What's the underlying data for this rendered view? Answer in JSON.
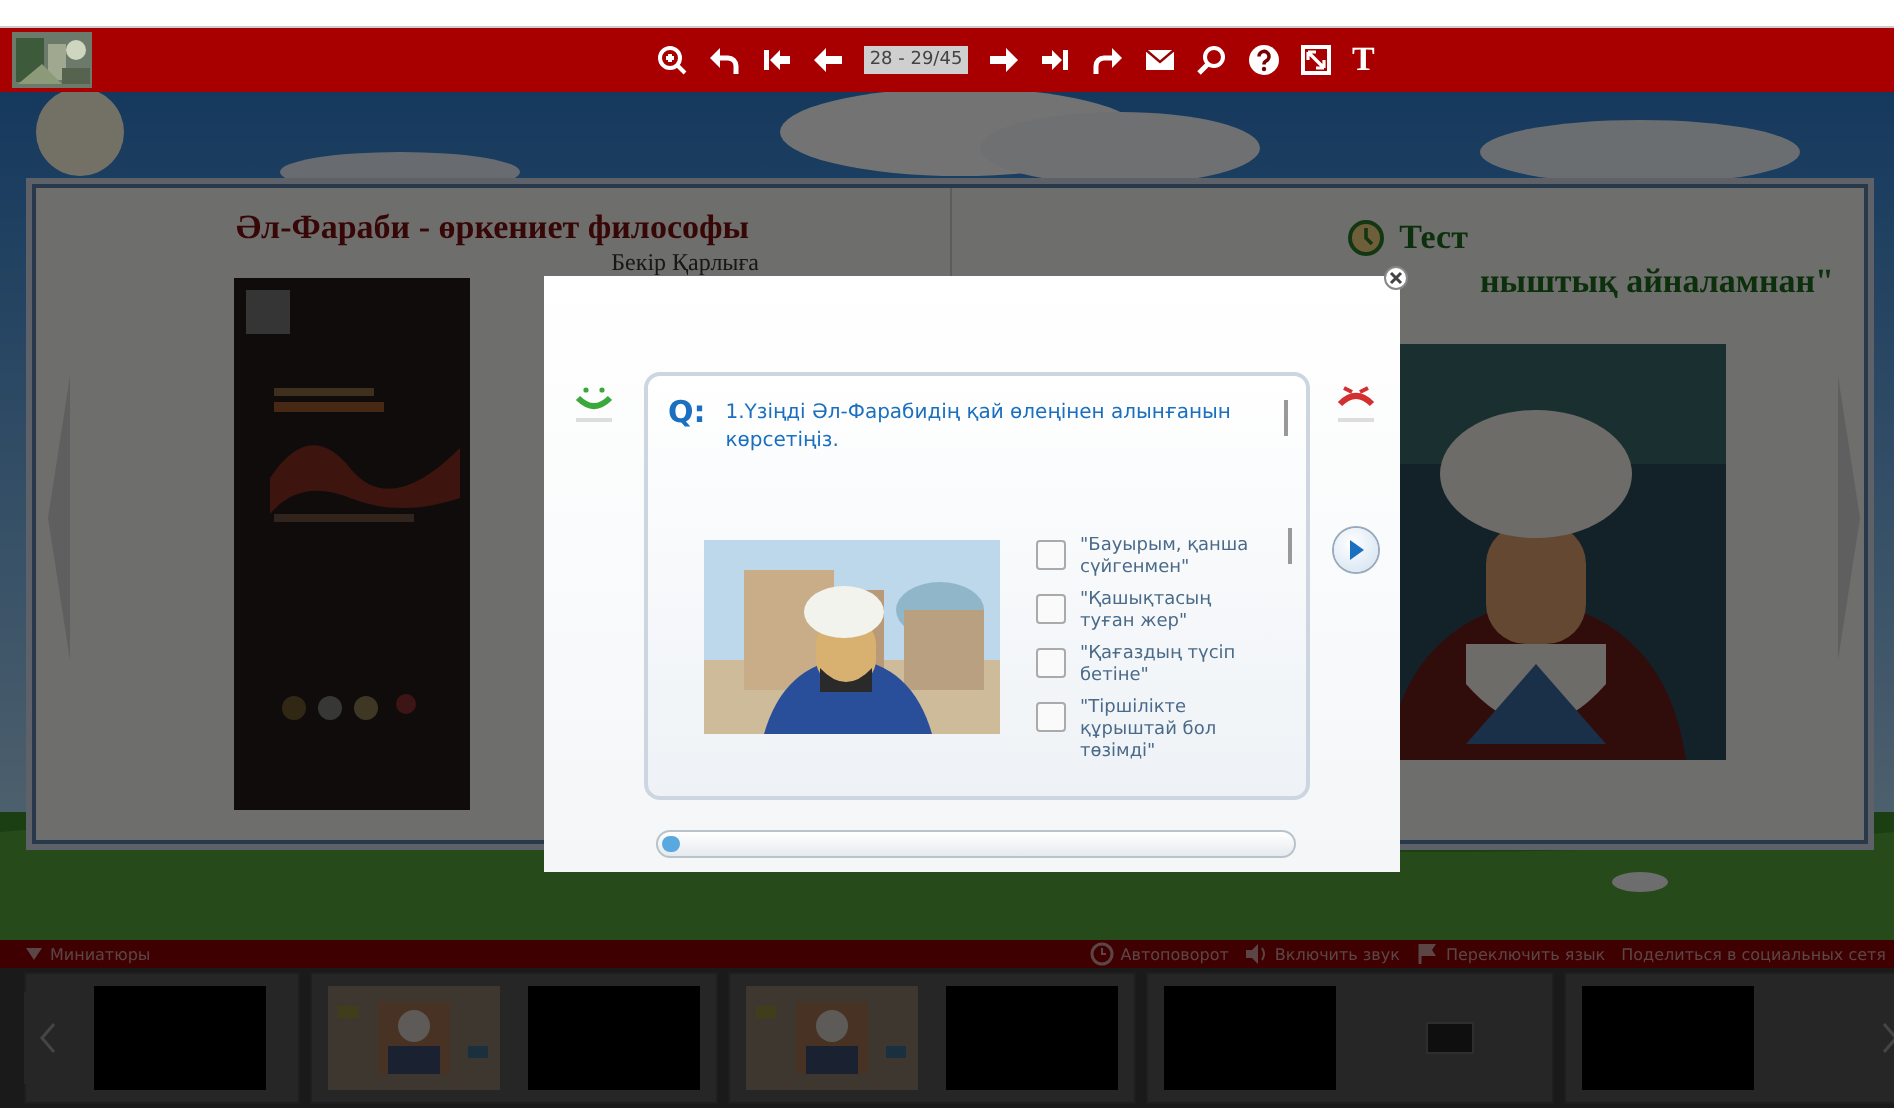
{
  "toolbar": {
    "buttons": [
      {
        "kind": "zoom-in"
      },
      {
        "kind": "undo"
      },
      {
        "kind": "first"
      },
      {
        "kind": "prev"
      },
      {
        "kind": "counter",
        "label": "28 - 29/45"
      },
      {
        "kind": "next"
      },
      {
        "kind": "last"
      },
      {
        "kind": "redo"
      },
      {
        "kind": "mail"
      },
      {
        "kind": "search"
      },
      {
        "kind": "help"
      },
      {
        "kind": "fullscreen"
      },
      {
        "kind": "text",
        "label": "T"
      }
    ]
  },
  "book": {
    "left_page": {
      "title": "Әл-Фараби - өркениет философы",
      "author": "Бекір Қарлыға"
    },
    "right_page": {
      "heading": "Тест",
      "title_fragment": "ныштық айналамнан\""
    }
  },
  "quiz": {
    "question_mark": "Q:",
    "question": "1.Үзіңді Әл-Фарабидің қай өлеңінен алынғанын көрсетіңіз.",
    "options": [
      {
        "label": "\"Бауырым, қанша сүйгенмен\"",
        "checked": false
      },
      {
        "label": "\"Қашықтасың туған жер\"",
        "checked": false
      },
      {
        "label": "\"Қағаздың түсіп бетіне\"",
        "checked": false
      },
      {
        "label": "\"Тіршілікте құрыштай бол төзімді\"",
        "checked": false
      }
    ],
    "progress": {
      "level": 0.03
    }
  },
  "bottom_bar": {
    "thumbnails_label": "Миниатюры",
    "actions": [
      {
        "kind": "autoturn",
        "label": "Автоповорот"
      },
      {
        "kind": "sound",
        "label": "Включить звук"
      },
      {
        "kind": "language",
        "label": "Переключить язык"
      },
      {
        "kind": "share",
        "label": "Поделиться в социальных сетя"
      }
    ]
  },
  "thumbnails": [
    {
      "pages": [
        {
          "kind": "blank"
        }
      ]
    },
    {
      "pages": [
        {
          "kind": "picture"
        },
        {
          "kind": "blank"
        }
      ]
    },
    {
      "pages": [
        {
          "kind": "picture"
        },
        {
          "kind": "blank"
        }
      ]
    },
    {
      "pages": [
        {
          "kind": "blank"
        },
        {
          "kind": "button"
        }
      ]
    },
    {
      "pages": [
        {
          "kind": "blank"
        },
        {
          "kind": "empty"
        }
      ]
    }
  ]
}
